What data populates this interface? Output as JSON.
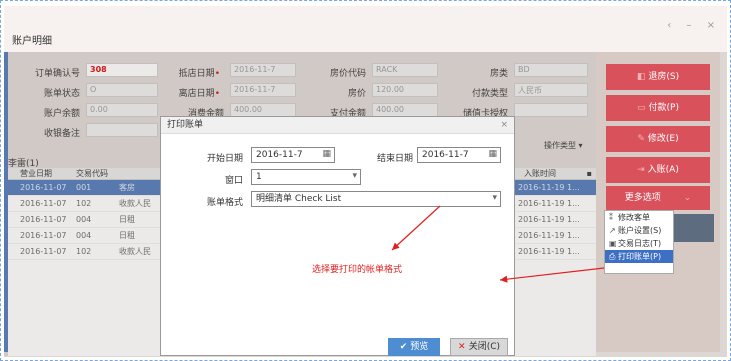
{
  "window": {
    "title": "账户明细",
    "controls": "‹ – ×"
  },
  "form": {
    "order_no": {
      "label": "订单确认号",
      "value": "308"
    },
    "bill_status": {
      "label": "账单状态",
      "value": "O"
    },
    "balance": {
      "label": "账户余额",
      "value": "0.00"
    },
    "remark": {
      "label": "收银备注",
      "value": ""
    },
    "arrive": {
      "label": "抵店日期",
      "value": "2016-11-7"
    },
    "depart": {
      "label": "离店日期",
      "value": "2016-11-7"
    },
    "consume": {
      "label": "消费金额",
      "value": "400.00"
    },
    "rate_code": {
      "label": "房价代码",
      "value": "RACK"
    },
    "rate": {
      "label": "房价",
      "value": "120.00"
    },
    "pay_amount": {
      "label": "支付金额",
      "value": "400.00"
    },
    "room_type": {
      "label": "房类",
      "value": "BD"
    },
    "pay_type": {
      "label": "付款类型",
      "value": "人民币"
    },
    "card_auth": {
      "label": "储值卡授权",
      "value": ""
    }
  },
  "tab_label": "李雷(1)",
  "op_type_label": "操作类型",
  "grid": {
    "headers": [
      "营业日期",
      "交易代码",
      ""
    ],
    "rows": [
      {
        "date": "2016-11-07",
        "code": "001",
        "desc": "客房"
      },
      {
        "date": "2016-11-07",
        "code": "102",
        "desc": "收款人民"
      },
      {
        "date": "2016-11-07",
        "code": "004",
        "desc": "日租"
      },
      {
        "date": "2016-11-07",
        "code": "004",
        "desc": "日租"
      },
      {
        "date": "2016-11-07",
        "code": "102",
        "desc": "收款人民"
      }
    ]
  },
  "right_grid": {
    "header": "入账时间",
    "rows": [
      "2016-11-19 1...",
      "2016-11-19 1...",
      "2016-11-19 1...",
      "2016-11-19 1...",
      "2016-11-19 1..."
    ]
  },
  "actions": {
    "checkout": "退房(S)",
    "pay": "付款(P)",
    "modify": "修改(E)",
    "post": "入账(A)",
    "more": "更多选项"
  },
  "menu": [
    {
      "icon": "⁑",
      "label": "修改客单"
    },
    {
      "icon": "↗",
      "label": "账户设置(S)"
    },
    {
      "icon": "▣",
      "label": "交易日志(T)"
    },
    {
      "icon": "⎙",
      "label": "打印账单(P)"
    }
  ],
  "dialog": {
    "title": "打印账单",
    "close": "×",
    "start_label": "开始日期",
    "start_value": "2016-11-7",
    "end_label": "结束日期",
    "end_value": "2016-11-7",
    "window_label": "窗口",
    "window_value": "1",
    "format_label": "账单格式",
    "format_value": "明细清单  Check List",
    "preview": "预览",
    "close_btn": "关闭(C)"
  },
  "annotation": "选择要打印的帐单格式",
  "colors": {
    "accent_red": "#d9525b",
    "selection_blue": "#4a76b8",
    "annotation_red": "#e02020"
  }
}
